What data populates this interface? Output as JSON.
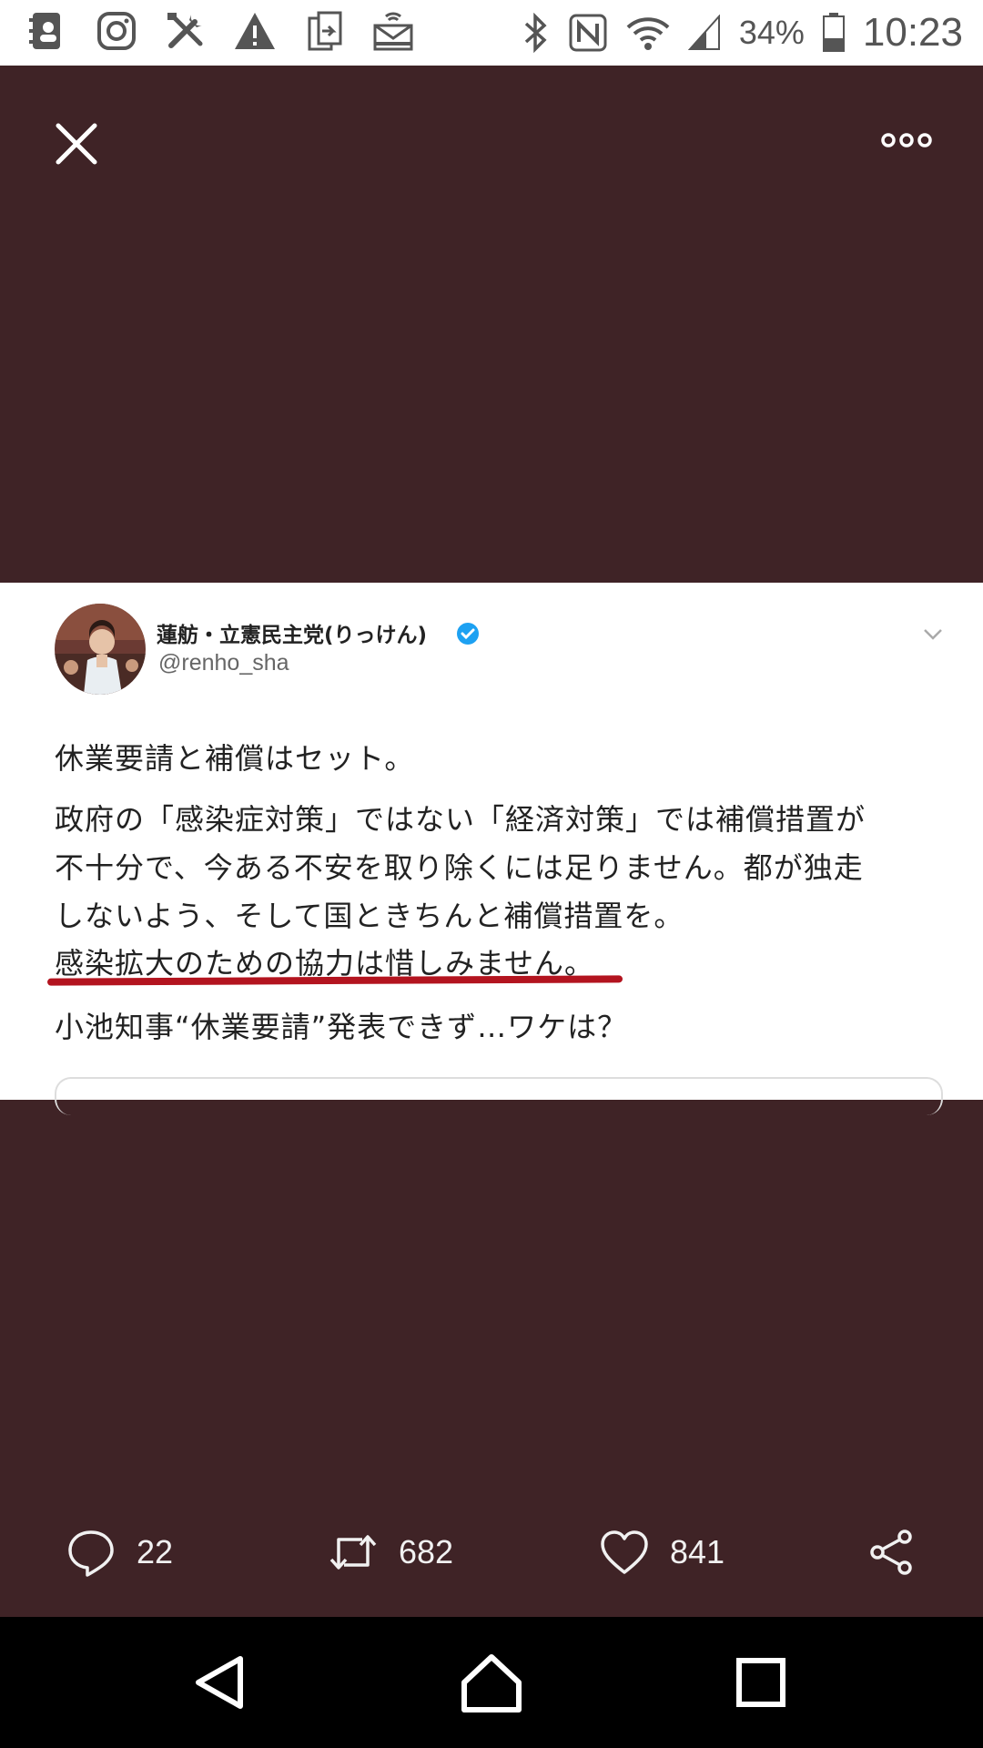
{
  "status_bar": {
    "battery": "34%",
    "time": "10:23",
    "icons": [
      "contacts-icon",
      "instagram-icon",
      "tools-icon",
      "warning-icon",
      "file-transfer-icon",
      "inbox-icon",
      "bluetooth-icon",
      "nfc-icon",
      "wifi-icon",
      "signal-icon",
      "battery-icon"
    ]
  },
  "viewer": {
    "close_icon": "close-icon",
    "more_icon": "more-options-icon"
  },
  "tweet": {
    "display_name": "蓮舫・立憲民主党(りっけん)",
    "handle": "@renho_sha",
    "lines": [
      "休業要請と補償はセット。",
      "政府の「感染症対策」ではない「経済対策」では補償措置が",
      "不十分で、今ある不安を取り除くには足りません。都が独走",
      "しないよう、そして国ときちんと補償措置を。",
      "感染拡大のための協力は惜しみません。",
      "小池知事“休業要請”発表できず…ワケは？"
    ],
    "underline_color": "#b3141f"
  },
  "actions": {
    "reply_count": "22",
    "retweet_count": "682",
    "like_count": "841"
  },
  "colors": {
    "viewer_bg": "#3f2326",
    "nav_bg": "#000000",
    "status_bg": "#ffffff"
  }
}
